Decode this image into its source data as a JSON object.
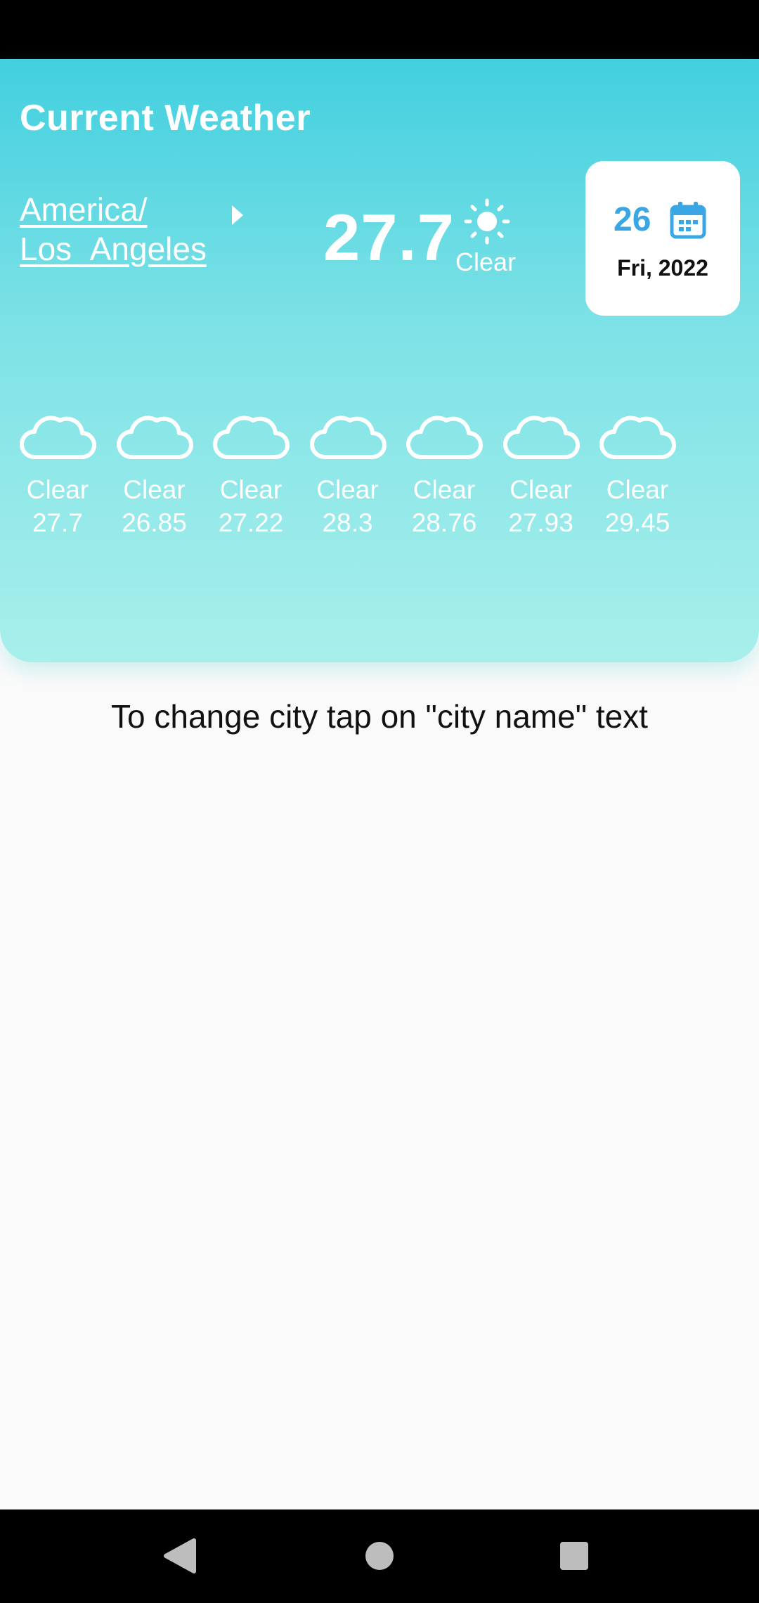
{
  "header": {
    "title": "Current Weather",
    "city": "America/ Los_Angeles",
    "temperature": "27.7",
    "condition": "Clear",
    "date_day": "26",
    "date_sub": "Fri, 2022",
    "colors": {
      "gradient_top": "#42cfdf",
      "gradient_bottom": "#a8efeb",
      "accent": "#3aa7e4"
    }
  },
  "forecast": [
    {
      "condition": "Clear",
      "temp": "27.7",
      "icon": "cloud-icon"
    },
    {
      "condition": "Clear",
      "temp": "26.85",
      "icon": "cloud-icon"
    },
    {
      "condition": "Clear",
      "temp": "27.22",
      "icon": "cloud-icon"
    },
    {
      "condition": "Clear",
      "temp": "28.3",
      "icon": "cloud-icon"
    },
    {
      "condition": "Clear",
      "temp": "28.76",
      "icon": "cloud-icon"
    },
    {
      "condition": "Clear",
      "temp": "27.93",
      "icon": "cloud-icon"
    },
    {
      "condition": "Clear",
      "temp": "29.45",
      "icon": "cloud-icon"
    }
  ],
  "hint": "To change city tap on \"city name\" text",
  "navigation": {
    "back_icon": "back-triangle-icon",
    "home_icon": "home-circle-icon",
    "recents_icon": "recents-square-icon"
  }
}
